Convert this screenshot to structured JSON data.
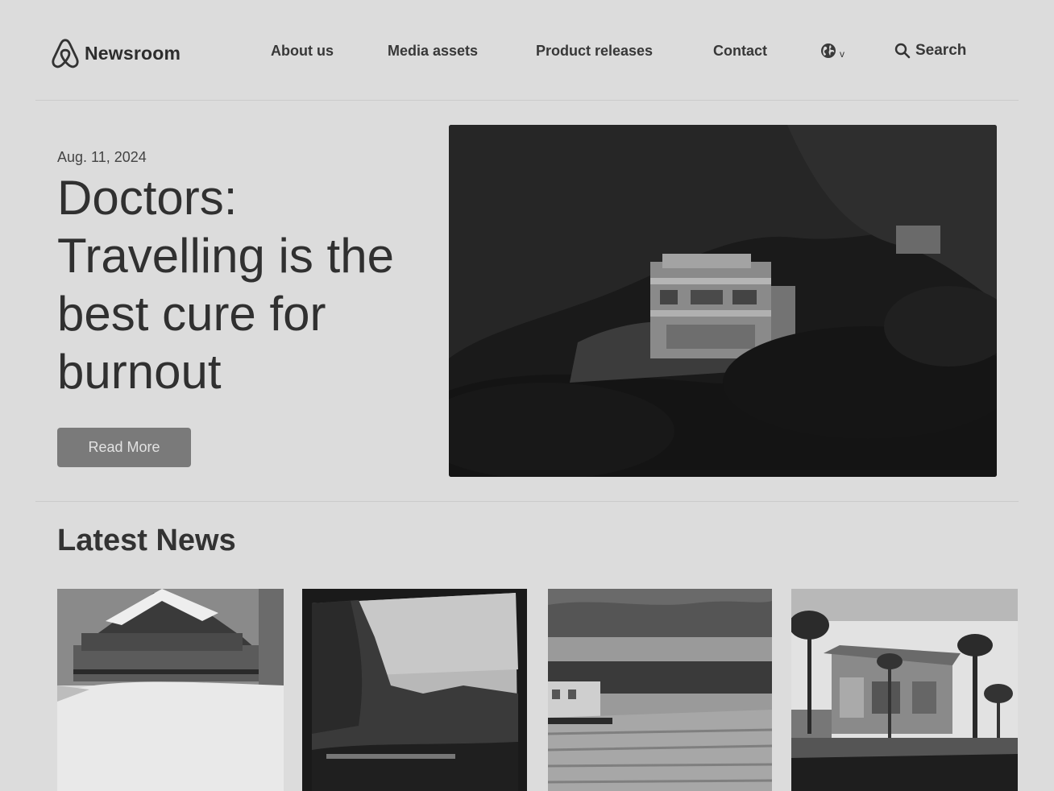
{
  "header": {
    "logo_text": "Newsroom",
    "nav": {
      "about": "About us",
      "media": "Media assets",
      "releases": "Product releases",
      "contact": "Contact"
    },
    "language_caret": "v",
    "search_label": "Search"
  },
  "hero": {
    "date": "Aug. 11, 2024",
    "title": "Doctors: Travelling is the best cure for burnout",
    "button_label": "Read More"
  },
  "latest": {
    "heading": "Latest News"
  },
  "icons": {
    "logo": "airbnb-logo-icon",
    "language": "globe-icon",
    "search": "search-icon"
  }
}
